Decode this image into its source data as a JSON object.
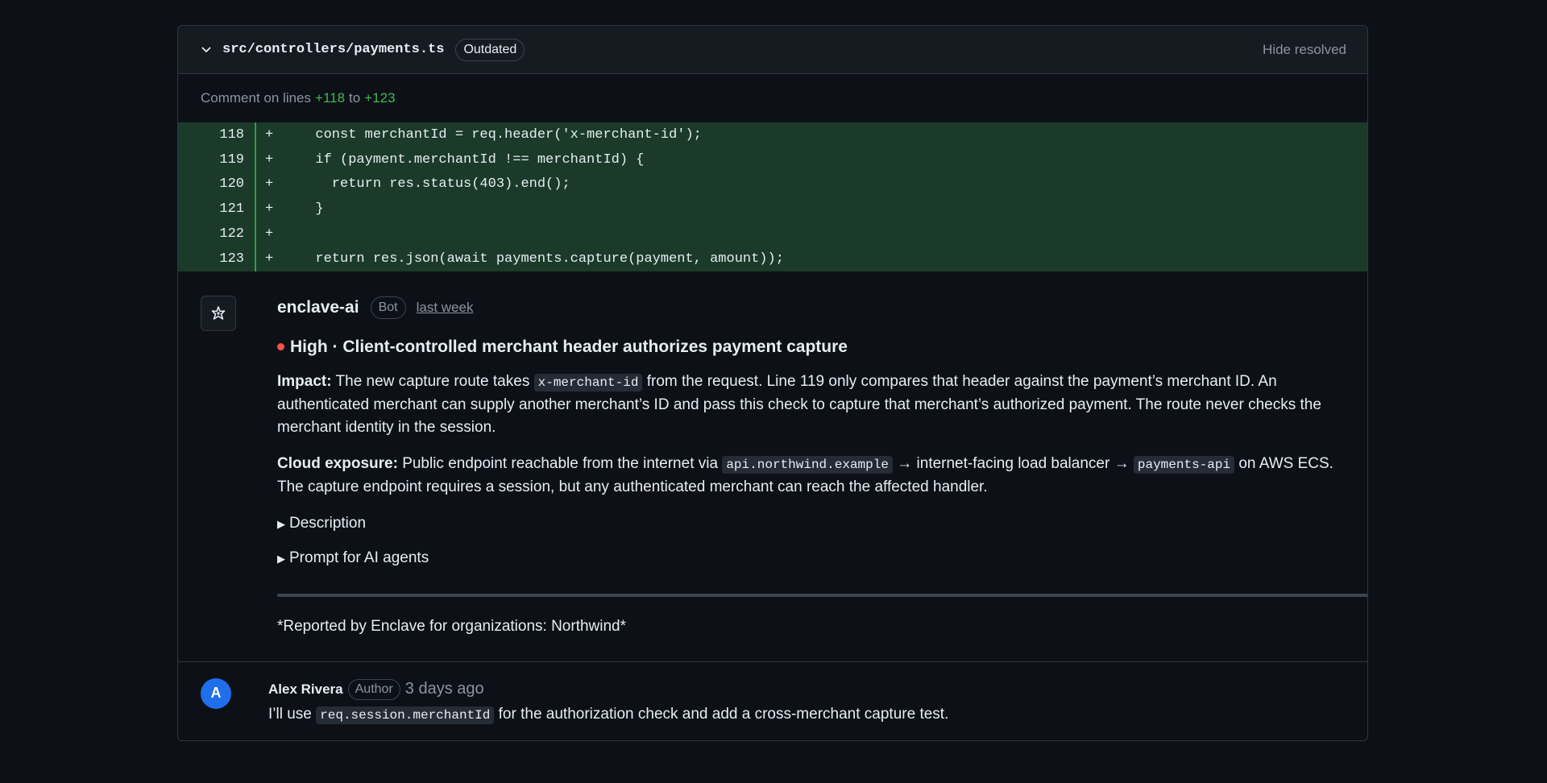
{
  "file": {
    "path": "src/controllers/payments.ts",
    "status_badge": "Outdated",
    "hide_resolved": "Hide resolved"
  },
  "comment_range": {
    "prefix": "Comment on lines",
    "start": "+118",
    "sep": "to",
    "end": "+123"
  },
  "diff": [
    {
      "line": "118",
      "sign": "+",
      "code": "  const merchantId = req.header('x-merchant-id');"
    },
    {
      "line": "119",
      "sign": "+",
      "code": "  if (payment.merchantId !== merchantId) {"
    },
    {
      "line": "120",
      "sign": "+",
      "code": "    return res.status(403).end();"
    },
    {
      "line": "121",
      "sign": "+",
      "code": "  }"
    },
    {
      "line": "122",
      "sign": "+",
      "code": ""
    },
    {
      "line": "123",
      "sign": "+",
      "code": "  return res.json(await payments.capture(payment, amount));"
    }
  ],
  "bot_comment": {
    "author": "enclave-ai",
    "badge": "Bot",
    "time": "last week",
    "severity_color": "#f85149",
    "title": "High · Client-controlled merchant header authorizes payment capture",
    "impact_label": "Impact:",
    "impact_1": "The new capture route takes",
    "impact_code": "x-merchant-id",
    "impact_2": "from the request. Line 119 only compares that header against the payment’s merchant ID. An authenticated merchant can supply another merchant’s ID and pass this check to capture that merchant’s authorized payment. The route never checks the merchant identity in the session.",
    "cloud_label": "Cloud exposure:",
    "cloud_1": "Public endpoint reachable from the internet via",
    "cloud_code1": "api.northwind.example",
    "cloud_2": "→ internet-facing load balancer →",
    "cloud_code2": "payments-api",
    "cloud_3": "on AWS ECS. The capture endpoint requires a session, but any authenticated merchant can reach the affected handler.",
    "details_description": "Description",
    "details_prompt": "Prompt for AI agents",
    "footer": "*Reported by Enclave for organizations: Northwind*"
  },
  "author_comment": {
    "avatar_letter": "A",
    "author": "Alex Rivera",
    "badge": "Author",
    "time": "3 days ago",
    "text_1": "I’ll use",
    "text_code": "req.session.merchantId",
    "text_2": "for the authorization check and add a cross-merchant capture test."
  }
}
